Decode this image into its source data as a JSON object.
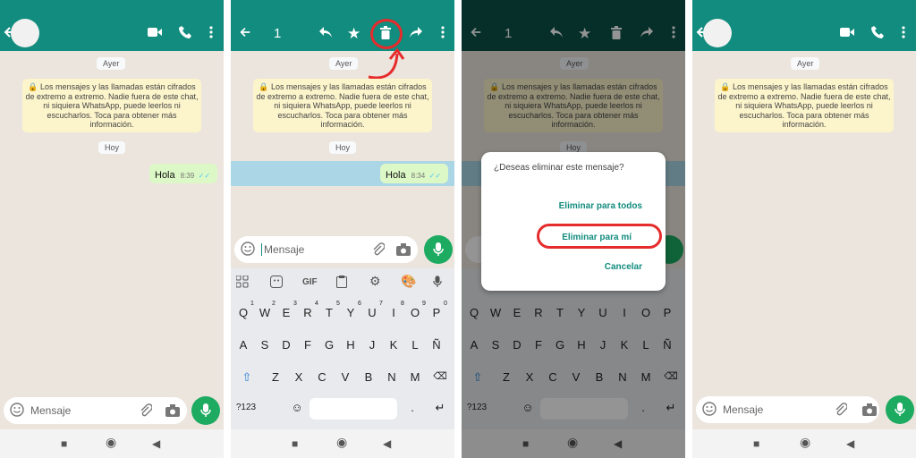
{
  "colors": {
    "header": "#128c7e",
    "header_dim": "#0b5148",
    "wallpaper": "#ece5dd",
    "bubble": "#dcf8c6",
    "mic": "#1daa61",
    "highlight": "#e52b2b"
  },
  "chat": {
    "date_yesterday": "Ayer",
    "date_today": "Hoy",
    "encryption_notice": "🔒 Los mensajes y las llamadas están cifrados de extremo a extremo. Nadie fuera de este chat, ni siquiera WhatsApp, puede leerlos ni escucharlos. Toca para obtener más información.",
    "message_text": "Hola",
    "message_time": "8:39",
    "message_time_selected": "8:34",
    "ticks": "✓✓"
  },
  "selection": {
    "count": "1"
  },
  "input": {
    "placeholder": "Mensaje"
  },
  "keyboard": {
    "row1": [
      "Q",
      "W",
      "E",
      "R",
      "T",
      "Y",
      "U",
      "I",
      "O",
      "P"
    ],
    "row1_digits": [
      "1",
      "2",
      "3",
      "4",
      "5",
      "6",
      "7",
      "8",
      "9",
      "0"
    ],
    "row2": [
      "A",
      "S",
      "D",
      "F",
      "G",
      "H",
      "J",
      "K",
      "L",
      "Ñ"
    ],
    "row3": [
      "Z",
      "X",
      "C",
      "V",
      "B",
      "N",
      "M"
    ],
    "toggle": "?123",
    "gif": "GIF",
    "period": "."
  },
  "dialog": {
    "question": "¿Deseas eliminar este mensaje?",
    "delete_for_all": "Eliminar para todos",
    "delete_for_me": "Eliminar para mí",
    "cancel": "Cancelar"
  },
  "icons": [
    "back-arrow-icon",
    "video-call-icon",
    "phone-icon",
    "more-vert-icon",
    "reply-icon",
    "star-icon",
    "delete-icon",
    "forward-icon",
    "emoji-icon",
    "attach-icon",
    "camera-icon",
    "mic-icon",
    "shift-icon",
    "backspace-icon",
    "enter-icon",
    "settings-icon",
    "palette-icon",
    "clipboard-icon",
    "sticker-icon",
    "apps-icon",
    "nav-square-icon",
    "nav-circle-icon",
    "nav-back-icon"
  ]
}
